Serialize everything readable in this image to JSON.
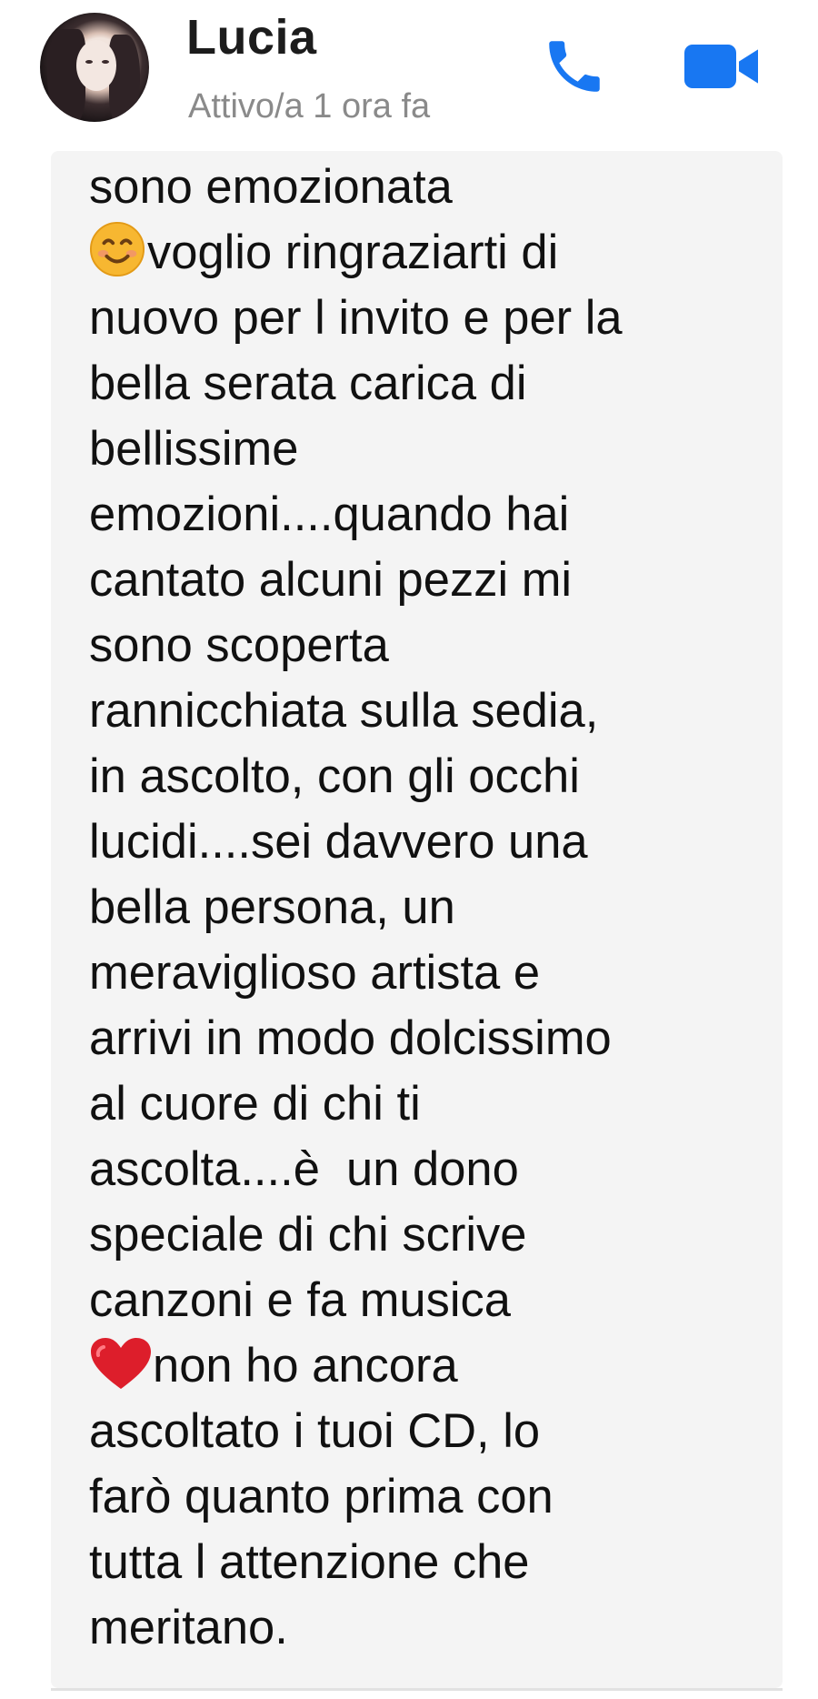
{
  "header": {
    "contact_name": "Lucia",
    "status": "Attivo/a 1 ora fa",
    "accent_color": "#1877f2",
    "icons": {
      "avatar": "avatar",
      "call": "phone-icon",
      "video": "video-camera-icon"
    }
  },
  "message": {
    "line1": "sono emozionata\n",
    "emoji1": "smiling-face-emoji",
    "part2": "voglio ringraziarti di\nnuovo per l invito e per la\nbella serata carica di\nbellissime\nemozioni....quando hai\ncantato alcuni pezzi mi\nsono scoperta\nrannicchiata sulla sedia,\nin ascolto, con gli occhi\nlucidi....sei davvero una\nbella persona, un\nmeraviglioso artista e\narrivi in modo dolcissimo\nal cuore di chi ti\nascolta....è  un dono\nspeciale di chi scrive\ncanzoni e fa musica\n",
    "emoji2": "red-heart-emoji",
    "part3": "non ho ancora\nascoltato i tuoi CD, lo\nfarò quanto prima con\ntutta l attenzione che\nmeritano."
  }
}
